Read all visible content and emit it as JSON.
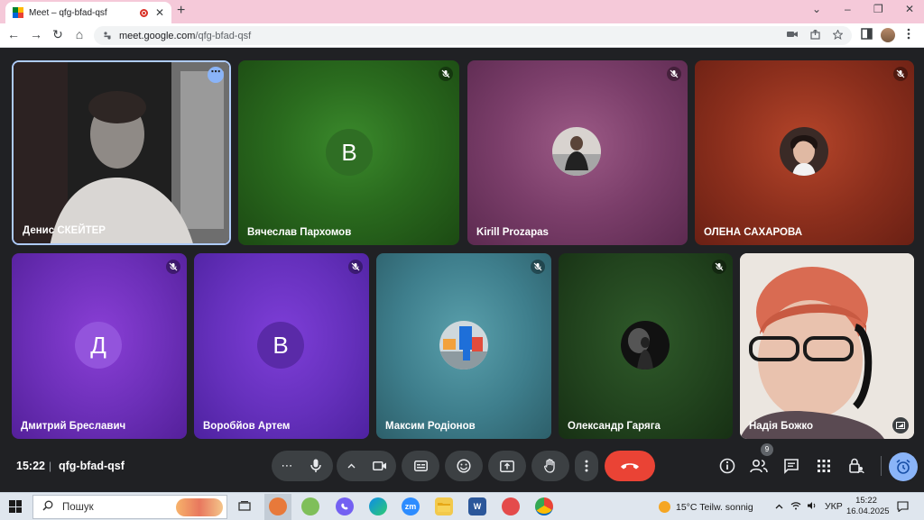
{
  "browser": {
    "tab_title": "Meet – qfg-bfad-qsf",
    "new_tab": "+",
    "url_host": "meet.google.com",
    "url_path": "/qfg-bfad-qsf",
    "window_controls": {
      "dropdown": "⌄",
      "minimize": "–",
      "restore": "❐",
      "close": "✕"
    },
    "nav": {
      "back": "←",
      "forward": "→",
      "reload": "↻",
      "home": "⌂"
    }
  },
  "participants": [
    {
      "name": "Денис СКЕЙТЕР",
      "kind": "video",
      "pinned_menu": true
    },
    {
      "name": "Вячеслав Пархомов",
      "kind": "letter",
      "letter": "В",
      "avatar_color": "#2f6e24",
      "muted": true
    },
    {
      "name": "Kirill Prozapas",
      "kind": "photo",
      "muted": true
    },
    {
      "name": "ОЛЕНА САХАРОВА",
      "kind": "photo",
      "muted": true
    },
    {
      "name": "Дмитрий Бреславич",
      "kind": "letter",
      "letter": "Д",
      "avatar_color": "#9354dc",
      "muted": true
    },
    {
      "name": "Воробйов Артем",
      "kind": "letter",
      "letter": "В",
      "avatar_color": "#5a2aa8",
      "muted": true
    },
    {
      "name": "Максим Родіонов",
      "kind": "photo",
      "muted": true
    },
    {
      "name": "Олександр Гаряга",
      "kind": "photo",
      "muted": true
    },
    {
      "name": "Надія Божко",
      "kind": "video"
    }
  ],
  "meeting": {
    "time": "15:22",
    "separator": "|",
    "code": "qfg-bfad-qsf",
    "participant_count": "9"
  },
  "taskbar": {
    "search_placeholder": "Пошук",
    "weather": "15°C  Teilw. sonnig",
    "language": "УКР",
    "time": "15:22",
    "date": "16.04.2025"
  },
  "colors": {
    "meet_bg": "#202124",
    "control_bg": "#3c4043",
    "end_call": "#ea4335",
    "accent": "#8ab4f8",
    "tab_strip": "#f5c9d9"
  }
}
